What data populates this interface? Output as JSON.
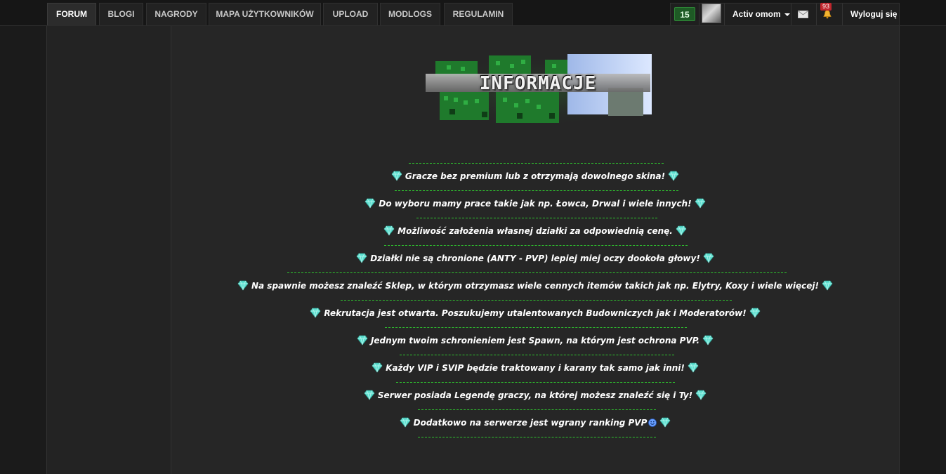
{
  "nav": {
    "tabs": [
      {
        "label": "FORUM",
        "active": true
      },
      {
        "label": "BLOGI",
        "active": false
      },
      {
        "label": "NAGRODY",
        "active": false
      },
      {
        "label": "MAPA UŻYTKOWNIKÓW",
        "active": false
      },
      {
        "label": "UPLOAD",
        "active": false
      },
      {
        "label": "MODLOGS",
        "active": false
      },
      {
        "label": "REGULAMIN",
        "active": false
      }
    ],
    "reputation_count": "15",
    "username": "Activ omom",
    "notifications_count": "93",
    "logout_label": "Wyloguj się",
    "icons": {
      "mail": "envelope-icon",
      "bell": "bell-icon",
      "dropdown": "caret-down-icon"
    }
  },
  "banner": {
    "title": "INFORMACJE"
  },
  "rules": {
    "items": [
      "Gracze bez premium lub z otrzymają dowolnego skina!",
      "Do wyboru mamy prace takie jak np. Łowca, Drwal i wiele innych!",
      "Możliwość założenia własnej działki za odpowiednią cenę.",
      "Działki nie są chronione (ANTY - PVP) lepiej miej oczy dookoła głowy!",
      "Na spawnie możesz znaleźć Sklep, w którym otrzymasz wiele cennych itemów takich jak np. Elytry, Koxy i wiele więcej!",
      "Rekrutacja jest otwarta. Poszukujemy utalentowanych Budowniczych jak i Moderatorów!",
      "Jednym twoim schronieniem jest Spawn, na którym jest ochrona PVP.",
      "Każdy VIP i SVIP będzie traktowany i karany tak samo jak inni!",
      "Serwer posiada Legendę graczy, na której możesz znaleźć się i Ty!",
      "Dodatkowo na serwerze jest wgrany ranking PVP"
    ],
    "bullet_icon": "diamond-gem-icon",
    "last_item_emoji": "smiley-icon"
  },
  "colors": {
    "accent": "#2fc62f",
    "badge_green": "#1e5a25",
    "notif_red": "#c0262d"
  }
}
